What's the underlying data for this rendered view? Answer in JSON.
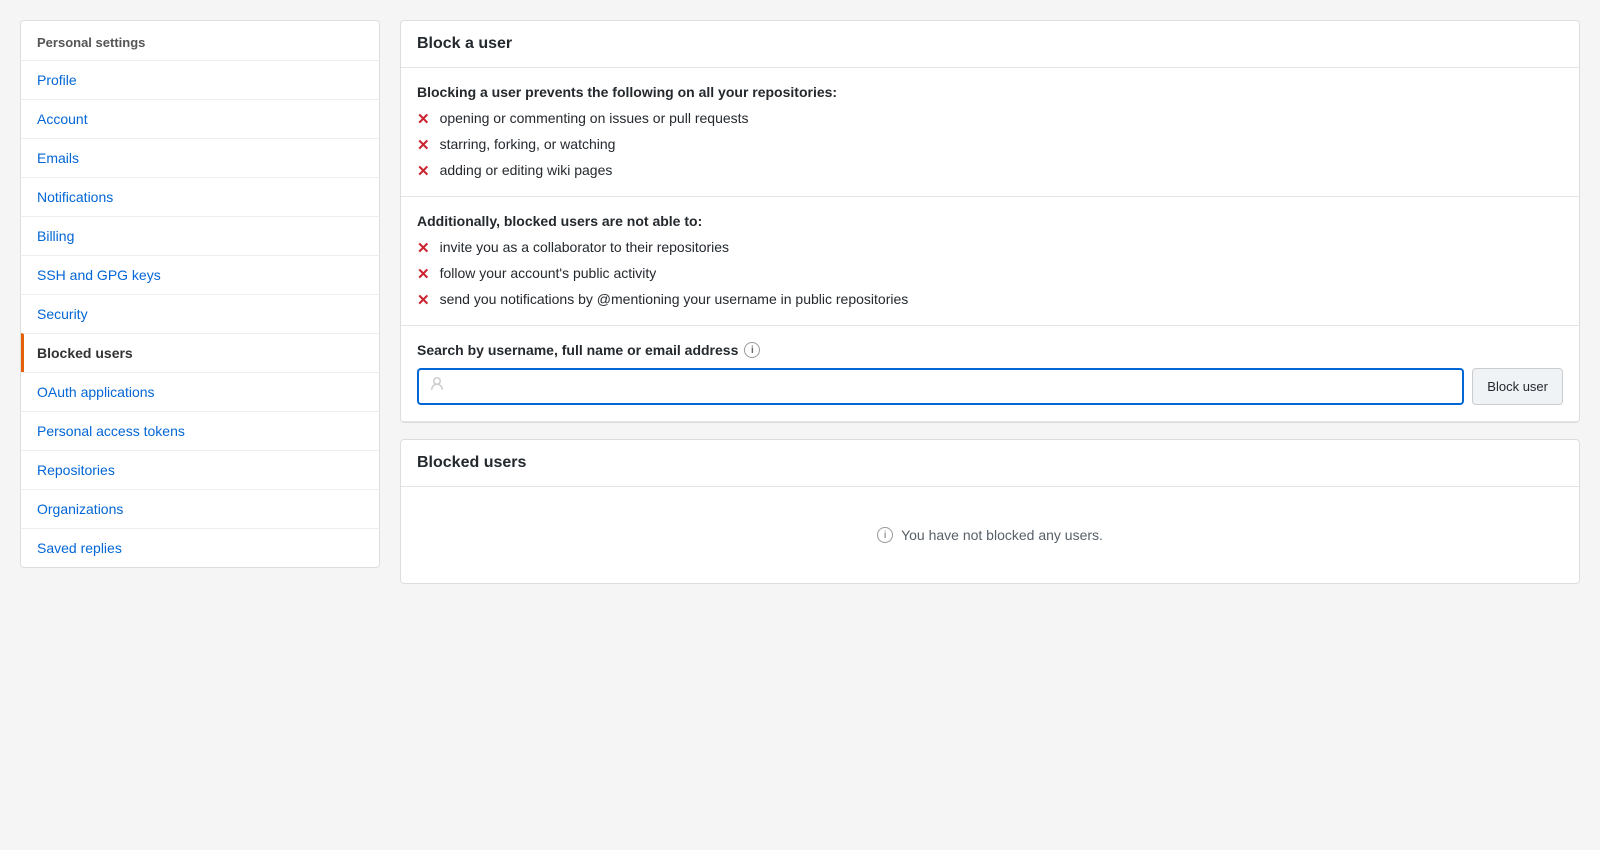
{
  "sidebar": {
    "header": "Personal settings",
    "items": [
      {
        "id": "profile",
        "label": "Profile",
        "active": false
      },
      {
        "id": "account",
        "label": "Account",
        "active": false
      },
      {
        "id": "emails",
        "label": "Emails",
        "active": false
      },
      {
        "id": "notifications",
        "label": "Notifications",
        "active": false
      },
      {
        "id": "billing",
        "label": "Billing",
        "active": false
      },
      {
        "id": "ssh-gpg-keys",
        "label": "SSH and GPG keys",
        "active": false
      },
      {
        "id": "security",
        "label": "Security",
        "active": false
      },
      {
        "id": "blocked-users",
        "label": "Blocked users",
        "active": true
      },
      {
        "id": "oauth-applications",
        "label": "OAuth applications",
        "active": false
      },
      {
        "id": "personal-access-tokens",
        "label": "Personal access tokens",
        "active": false
      },
      {
        "id": "repositories",
        "label": "Repositories",
        "active": false
      },
      {
        "id": "organizations",
        "label": "Organizations",
        "active": false
      },
      {
        "id": "saved-replies",
        "label": "Saved replies",
        "active": false
      }
    ]
  },
  "main": {
    "block_a_user_title": "Block a user",
    "blocking_prevents_heading": "Blocking a user prevents the following on all your repositories:",
    "blocking_prevents_items": [
      "opening or commenting on issues or pull requests",
      "starring, forking, or watching",
      "adding or editing wiki pages"
    ],
    "additionally_heading": "Additionally, blocked users are not able to:",
    "additionally_items": [
      "invite you as a collaborator to their repositories",
      "follow your account's public activity",
      "send you notifications by @mentioning your username in public repositories"
    ],
    "search_label": "Search by username, full name or email address",
    "search_placeholder": "",
    "block_user_button": "Block user",
    "blocked_users_title": "Blocked users",
    "empty_state_text": "You have not blocked any users."
  }
}
